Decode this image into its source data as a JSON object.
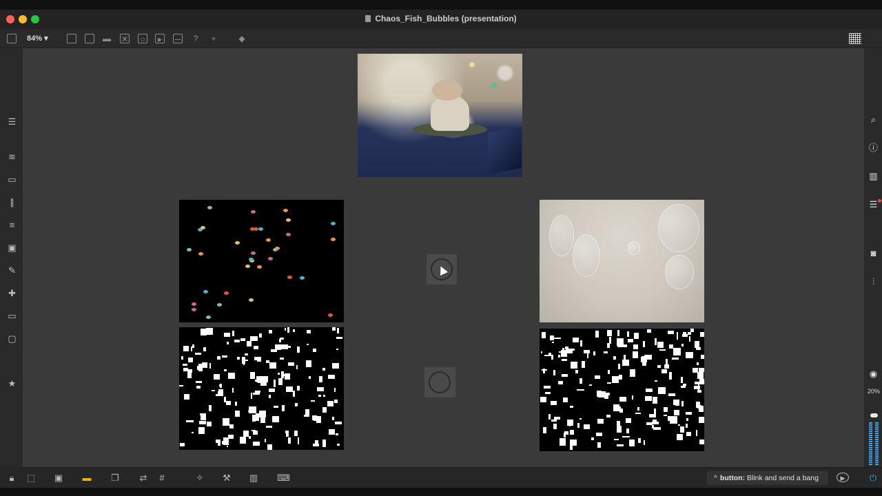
{
  "window": {
    "title": "Chaos_Fish_Bubbles (presentation)"
  },
  "toolbar": {
    "zoom": "84%",
    "zoom_caret": "▾"
  },
  "status": {
    "caret": "^",
    "object": "button:",
    "description": "Blink and send a bang"
  },
  "mixer": {
    "volume_label": "20%",
    "volume_level": 0.2
  },
  "colors": {
    "accent_blue": "#3ca6f0",
    "active_yellow": "#f0b400",
    "notification_red": "#e94b3c"
  }
}
